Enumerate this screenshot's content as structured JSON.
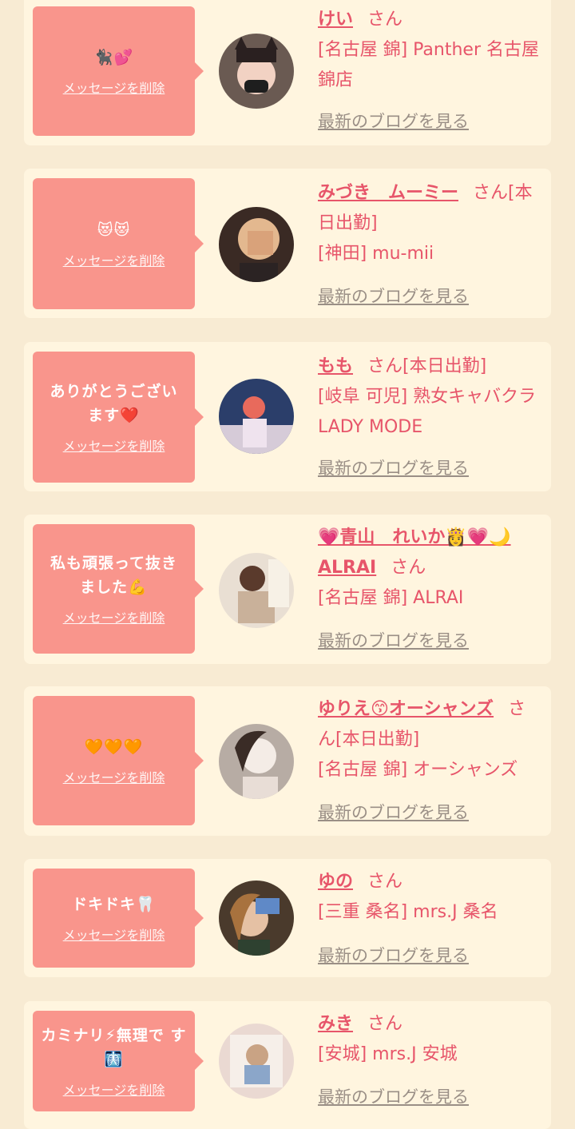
{
  "colors": {
    "page_bg": "#f8ebd3",
    "card_bg": "#fff5df",
    "bubble": "#f9958c",
    "accent_text": "#e7556a",
    "muted_link": "#9a8f86"
  },
  "delete_label": "メッセージを削除",
  "blog_label": "最新のブログを見る",
  "honorific": "さん",
  "cards": [
    {
      "message": "🐈‍⬛💕",
      "name": "けい",
      "suffix": "さん",
      "lines": [
        "[名古屋 錦] Panther 名古屋",
        "錦店"
      ]
    },
    {
      "message": "😻😻",
      "name": "みづき　ムーミー",
      "suffix": "さん[本",
      "lines": [
        "日出勤]",
        "[神田] mu-mii"
      ]
    },
    {
      "message": "ありがとうござい ます❤️",
      "name": "もも",
      "suffix": "さん[本日出勤]",
      "lines": [
        "[岐阜 可児] 熟女キャバクラ",
        "LADY MODE"
      ]
    },
    {
      "message": "私も頑張って抜き ました💪",
      "name": "💗青山　れいか👸💗🌙",
      "name2": "ALRAI",
      "suffix": "さん",
      "lines": [
        "[名古屋 錦] ALRAI"
      ]
    },
    {
      "message": "🧡🧡🧡",
      "name": "ゆりえ😙オーシャンズ",
      "suffix": "さ",
      "lines": [
        "ん[本日出勤]",
        "[名古屋 錦] オーシャンズ"
      ]
    },
    {
      "message": "ドキドキ🦷",
      "name": "ゆの",
      "suffix": "さん",
      "lines": [
        "[三重 桑名] mrs.J 桑名"
      ]
    },
    {
      "message": "カミナリ⚡無理で す🩻",
      "name": "みき",
      "suffix": "さん",
      "lines": [
        "[安城] mrs.J 安城"
      ]
    }
  ]
}
